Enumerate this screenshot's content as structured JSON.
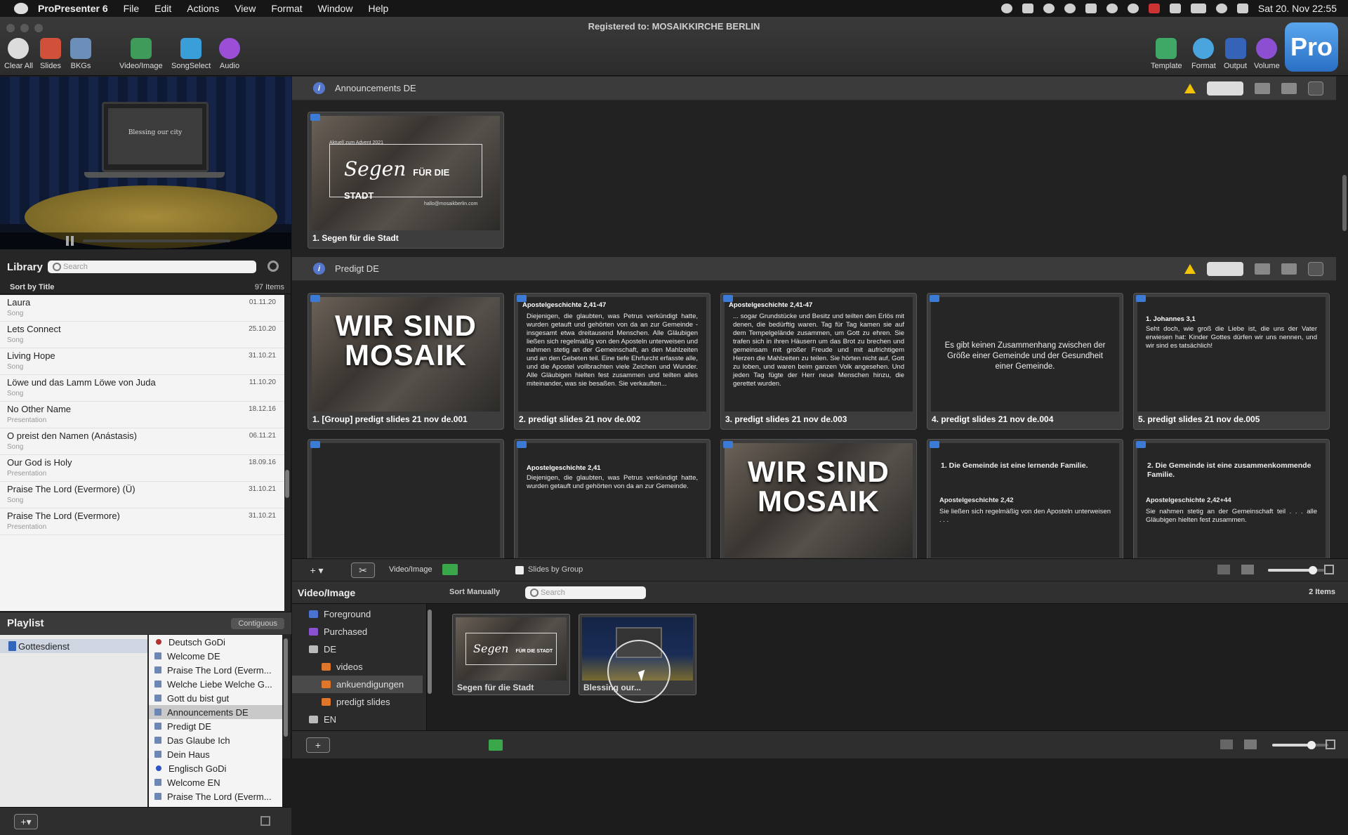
{
  "menubar": {
    "app": "ProPresenter 6",
    "items": [
      "File",
      "Edit",
      "Actions",
      "View",
      "Format",
      "Window",
      "Help"
    ],
    "clock": "Sat 20. Nov  22:55"
  },
  "window": {
    "title": "Registered to: MOSAIKKIRCHE BERLIN"
  },
  "toolbar": {
    "left": [
      "Clear All",
      "Slides",
      "BKGs",
      "Video/Image",
      "SongSelect",
      "Audio"
    ],
    "right": [
      "Template",
      "Format",
      "Output",
      "Volume"
    ],
    "pro_logo": "Pro"
  },
  "preview": {
    "slide_text": "Blessing our city"
  },
  "library": {
    "title": "Library",
    "search_placeholder": "Search",
    "sort_label": "Sort by Title",
    "count": "97 Items",
    "items": [
      {
        "name": "Laura",
        "kind": "Song",
        "date": "01.11.20"
      },
      {
        "name": "Lets Connect",
        "kind": "Song",
        "date": "25.10.20"
      },
      {
        "name": "Living Hope",
        "kind": "Song",
        "date": "31.10.21"
      },
      {
        "name": "Löwe und das Lamm Löwe von Juda",
        "kind": "Song",
        "date": "11.10.20"
      },
      {
        "name": "No Other Name",
        "kind": "Presentation",
        "date": "18.12.16"
      },
      {
        "name": "O preist den Namen (Anástasis)",
        "kind": "Song",
        "date": "06.11.21"
      },
      {
        "name": "Our God is Holy",
        "kind": "Presentation",
        "date": "18.09.16"
      },
      {
        "name": "Praise The Lord (Evermore) (Ü)",
        "kind": "Song",
        "date": "31.10.21"
      },
      {
        "name": "Praise The Lord (Evermore)",
        "kind": "Presentation",
        "date": "31.10.21"
      }
    ]
  },
  "playlist": {
    "title": "Playlist",
    "mode": "Contiguous",
    "selected_playlist": "Gottesdienst",
    "items": [
      {
        "name": "Deutsch GoDi",
        "type": "header",
        "color": "#b23030"
      },
      {
        "name": "Welcome DE",
        "type": "doc"
      },
      {
        "name": "Praise The Lord (Everm...",
        "type": "doc"
      },
      {
        "name": "Welche Liebe Welche G...",
        "type": "doc"
      },
      {
        "name": "Gott du bist gut",
        "type": "doc"
      },
      {
        "name": "Announcements DE",
        "type": "doc",
        "selected": true
      },
      {
        "name": "Predigt DE",
        "type": "doc"
      },
      {
        "name": "Das Glaube Ich",
        "type": "doc"
      },
      {
        "name": "Dein Haus",
        "type": "doc"
      },
      {
        "name": "Englisch GoDi",
        "type": "header",
        "color": "#2a55c8"
      },
      {
        "name": "Welcome EN",
        "type": "doc"
      },
      {
        "name": "Praise The Lord (Everm...",
        "type": "doc"
      }
    ]
  },
  "groups": [
    {
      "name": "Announcements DE"
    },
    {
      "name": "Predigt DE"
    }
  ],
  "slides_announcements": [
    {
      "caption": "1. Segen für die Stadt",
      "top_text": "Aktuell zum Advent 2021",
      "script": "Segen",
      "title": "FÜR DIE STADT",
      "footer": "hallo@mosaikberlin.com"
    }
  ],
  "slides_predigt": [
    {
      "caption": "1. [Group] predigt slides 21 nov de.001",
      "style": "photo",
      "big": "WIR SIND MOSAIK"
    },
    {
      "caption": "2. predigt slides 21 nov de.002",
      "style": "text",
      "heading": "Apostelgeschichte 2,41-47",
      "body": "Diejenigen, die glaubten, was Petrus verkündigt hatte, wurden getauft und gehörten von da an zur Gemeinde - insgesamt etwa dreitausend Menschen. Alle Gläubigen ließen sich regelmäßig von den Aposteln unterweisen und nahmen stetig an der Gemeinschaft, an den Mahlzeiten und an den Gebeten teil. Eine tiefe Ehrfurcht erfasste alle, und die Apostel vollbrachten viele Zeichen und Wunder. Alle Gläubigen hielten fest zusammen und teilten alles miteinander, was sie besaßen. Sie verkauften..."
    },
    {
      "caption": "3. predigt slides 21 nov de.003",
      "style": "text",
      "heading": "Apostelgeschichte 2,41-47",
      "body": "... sogar Grundstücke und Besitz und teilten den Erlös mit denen, die bedürftig waren. Tag für Tag kamen sie auf dem Tempelgelände zusammen, um Gott zu ehren. Sie trafen sich in ihren Häusern um das Brot zu brechen und gemeinsam mit großer Freude und mit aufrichtigem Herzen die Mahlzeiten zu teilen. Sie hörten nicht auf, Gott zu loben, und waren beim ganzen Volk angesehen. Und jeden Tag fügte der Herr neue Menschen hinzu, die gerettet wurden."
    },
    {
      "caption": "4. predigt slides 21 nov de.004",
      "style": "center",
      "body": "Es gibt keinen Zusammenhang zwischen der Größe einer Gemeinde und der Gesundheit einer Gemeinde."
    },
    {
      "caption": "5. predigt slides 21 nov de.005",
      "style": "text",
      "heading": "1. Johannes 3,1",
      "body": "Seht doch, wie groß die Liebe ist, die uns der Vater erwiesen hat: Kinder Gottes dürfen wir uns nennen, und wir sind es tatsächlich!"
    },
    {
      "caption": "",
      "style": "blank"
    },
    {
      "caption": "",
      "style": "text",
      "heading": "Apostelgeschichte 2,41",
      "body": "Diejenigen, die glaubten, was Petrus verkündigt hatte, wurden getauft und gehörten von da an zur Gemeinde."
    },
    {
      "caption": "",
      "style": "photo",
      "big": "WIR SIND MOSAIK"
    },
    {
      "caption": "",
      "style": "point",
      "heading": "1. Die Gemeinde ist eine lernende Familie.",
      "sub": "Apostelgeschichte 2,42",
      "body": "Sie ließen sich regelmäßig von den Aposteln unterweisen . . ."
    },
    {
      "caption": "",
      "style": "point",
      "heading": "2. Die Gemeinde ist eine zusammenkommende Familie.",
      "sub": "Apostelgeschichte 2,42+44",
      "body": "Sie nahmen stetig an der Gemeinschaft teil . . . alle Gläubigen hielten fest zusammen."
    }
  ],
  "strip": {
    "media_label": "Video/Image",
    "slides_by_group": "Slides by Group",
    "zoom": 0.8
  },
  "bin": {
    "title": "Video/Image",
    "sort": "Sort Manually",
    "search_placeholder": "Search",
    "count": "2 Items",
    "tree": [
      {
        "name": "Foreground",
        "color": "#4a72d0",
        "indent": false
      },
      {
        "name": "Purchased",
        "color": "#8a52d0",
        "indent": false
      },
      {
        "name": "DE",
        "color": "#bbbbbb",
        "indent": false
      },
      {
        "name": "videos",
        "color": "#e0762a",
        "indent": true
      },
      {
        "name": "ankuendigungen",
        "color": "#e0762a",
        "indent": true,
        "selected": true
      },
      {
        "name": "predigt slides",
        "color": "#e0762a",
        "indent": true
      },
      {
        "name": "EN",
        "color": "#bbbbbb",
        "indent": false
      }
    ],
    "tiles": [
      {
        "caption": "Segen für die Stadt",
        "script": "Segen",
        "title": "FÜR DIE STADT"
      },
      {
        "caption": "Blessing our..."
      }
    ],
    "zoom": 0.7
  },
  "colors": {
    "accent": "#3b7bd6",
    "warning": "#f2c300"
  }
}
